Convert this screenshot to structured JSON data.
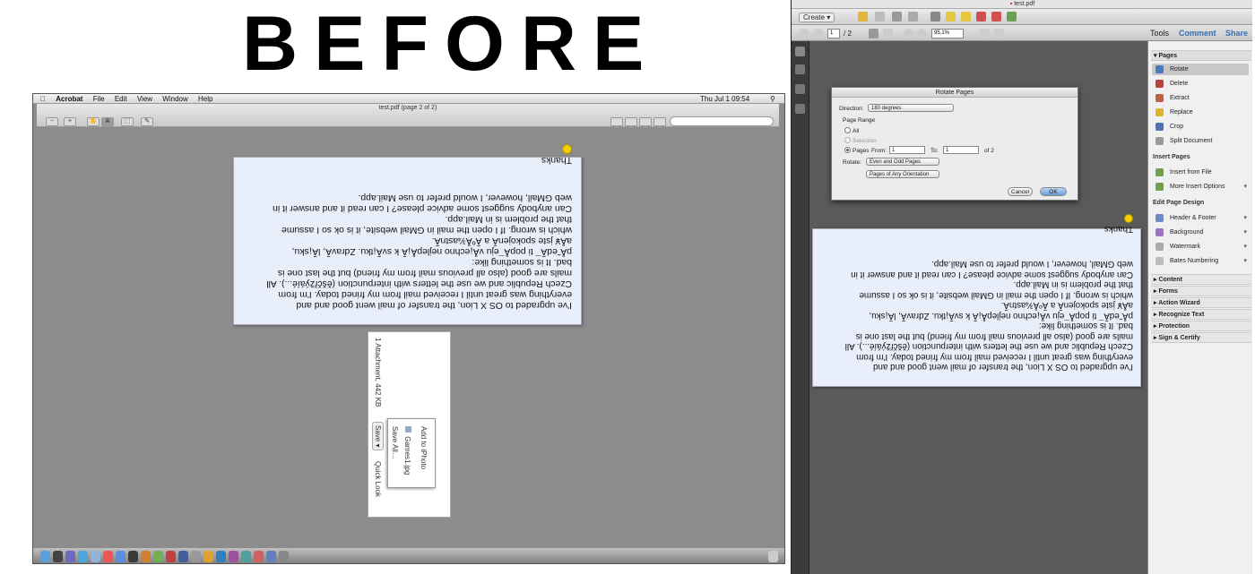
{
  "before_label": "BEFORE",
  "mac": {
    "apple_glyph": "",
    "app_name": "Acrobat",
    "menus": [
      "File",
      "Edit",
      "View",
      "Window",
      "Help"
    ],
    "clock": "Thu Jul 1 09:54",
    "window_title": "test.pdf (page 2 of 2)"
  },
  "email_text": "I've upgraded to OS X Lion, the transfer of mail went good and and\neverything was great until I received mail from my frined today. I'm from\nCzech Republic and we use the letters with interpunction (ěščřžýáíé...). All\nmails are good (also all previous mail from my friend) but the last one is\nbad. It is something like:\npÅ˜edÃ¯ ti popÅ¯eju vÅ¡echno nejlepÅ¡Ã­ k svÃ¡tku. ZdravÃ­, lÃ¡sku,\naÅ¥ jste spokojenÃ­ a ÃºÅ¾astnÃ­.\nwhich is wrong. If I open the mail in GMail website, it is ok so I assume\nthat the problem is in Mail.app.\nCan anybody suggest some advice please? I can read it and answer it in\nweb GMail, however, I would prefer to use Mail.app.",
  "thanks": "Thanks",
  "attachment": {
    "count_label": "1 Attachment, 442 KB",
    "save_label": "Save ▾",
    "quick_look": "Quick Look",
    "menu_items": [
      "Save All…",
      "Games1.jpg",
      "Add to iPhoto"
    ]
  },
  "acrobat": {
    "window_title": "test.pdf",
    "create_label": "Create ▾",
    "page_current": "1",
    "page_total": "/ 2",
    "zoom": "95.1%",
    "tabs": [
      "Tools",
      "Comment",
      "Share"
    ]
  },
  "dialog": {
    "title": "Rotate Pages",
    "direction_label": "Direction:",
    "direction_value": "180 degrees",
    "page_range_label": "Page Range",
    "all_label": "All",
    "selection_label": "Selection",
    "pages_label": "Pages",
    "from_label": "From:",
    "from_value": "1",
    "to_label": "To:",
    "to_value": "1",
    "of_label": "of 2",
    "rotate_label": "Rotate:",
    "rotate_value": "Even and Odd Pages",
    "orientation_value": "Pages of Any Orientation",
    "cancel": "Cancel",
    "ok": "OK"
  },
  "tools_panel": {
    "pages_header": "Pages",
    "page_tools": [
      "Rotate",
      "Delete",
      "Extract",
      "Replace",
      "Crop",
      "Split Document"
    ],
    "insert_header": "Insert Pages",
    "insert_tools": [
      "Insert from File",
      "More Insert Options"
    ],
    "edit_header": "Edit Page Design",
    "edit_tools": [
      "Header & Footer",
      "Background",
      "Watermark",
      "Bates Numbering"
    ],
    "sections": [
      "Content",
      "Forms",
      "Action Wizard",
      "Recognize Text",
      "Protection",
      "Sign & Certify"
    ]
  },
  "colors": {
    "accent_blue": "#3a6fb0",
    "page_bg": "#e9effa"
  }
}
